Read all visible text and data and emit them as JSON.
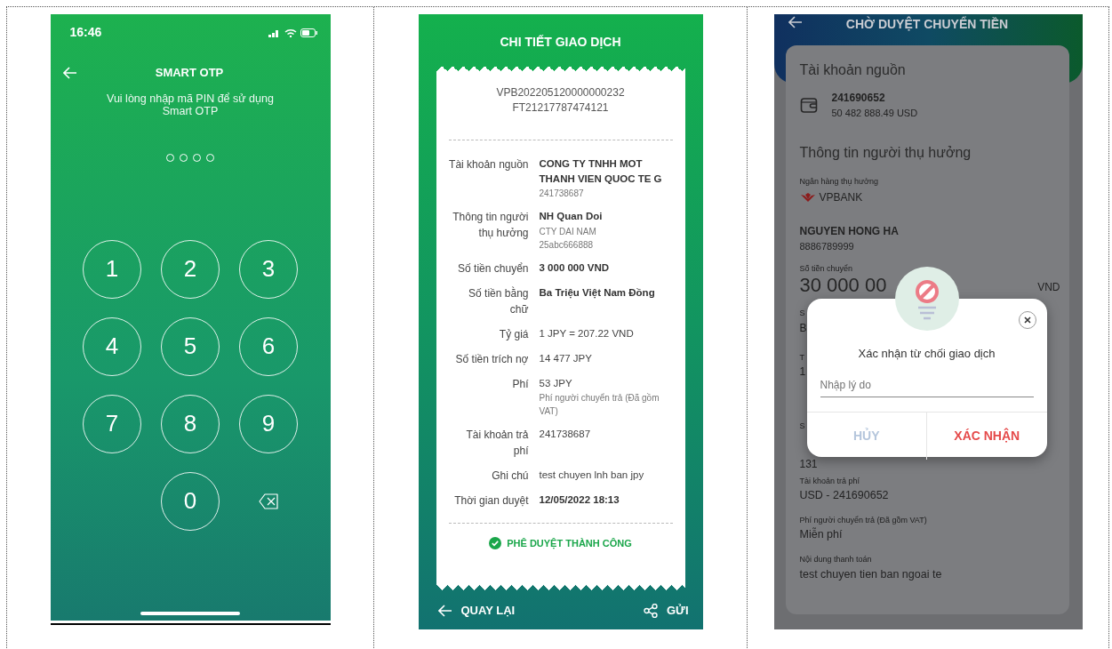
{
  "panel_1": {
    "status_bar": {
      "time": "16:46"
    },
    "title": "SMART OTP",
    "instruction": "Vui lòng nhập mã PIN để sử dụng Smart OTP",
    "pin_dots": [
      {
        "filled": false
      },
      {
        "filled": false
      },
      {
        "filled": false
      },
      {
        "filled": false
      }
    ],
    "keypad": [
      {
        "kind": "digit",
        "label": "1"
      },
      {
        "kind": "digit",
        "label": "2"
      },
      {
        "kind": "digit",
        "label": "3"
      },
      {
        "kind": "digit",
        "label": "4"
      },
      {
        "kind": "digit",
        "label": "5"
      },
      {
        "kind": "digit",
        "label": "6"
      },
      {
        "kind": "digit",
        "label": "7"
      },
      {
        "kind": "digit",
        "label": "8"
      },
      {
        "kind": "digit",
        "label": "9"
      },
      {
        "kind": "blank"
      },
      {
        "kind": "digit",
        "label": "0"
      },
      {
        "kind": "backspace"
      }
    ]
  },
  "panel_2": {
    "title": "CHI TIẾT GIAO DỊCH",
    "references": [
      "VPB202205120000000232",
      "FT21217787474121"
    ],
    "details": [
      {
        "label": "Tài khoản nguồn",
        "values": [
          {
            "kind": "bold",
            "text": "CONG TY TNHH MOT THANH VIEN QUOC TE G"
          },
          {
            "kind": "small",
            "text": "241738687"
          }
        ]
      },
      {
        "label": "Thông tin người thụ hưởng",
        "values": [
          {
            "kind": "bold",
            "text": "NH Quan Doi"
          },
          {
            "kind": "small",
            "text": "CTY DAI NAM"
          },
          {
            "kind": "small",
            "text": "25abc666888"
          }
        ]
      },
      {
        "label": "Số tiền chuyển",
        "values": [
          {
            "kind": "bold",
            "text": "3 000 000 VND"
          }
        ]
      },
      {
        "label": "Số tiền bằng chữ",
        "values": [
          {
            "kind": "bold",
            "text": "Ba Triệu Việt Nam Đồng"
          }
        ]
      },
      {
        "label": "Tỷ giá",
        "values": [
          {
            "kind": "normal",
            "text": "1 JPY = 207.22 VND"
          }
        ]
      },
      {
        "label": "Số tiền trích nợ",
        "values": [
          {
            "kind": "normal",
            "text": "14 477 JPY"
          }
        ]
      },
      {
        "label": "Phí",
        "values": [
          {
            "kind": "normal",
            "text": "53 JPY"
          },
          {
            "kind": "small",
            "text": "Phí người chuyển trả (Đã gồm VAT)"
          }
        ]
      },
      {
        "label": "Tài khoản trả phí",
        "values": [
          {
            "kind": "normal",
            "text": "241738687"
          }
        ]
      },
      {
        "label": "Ghi chú",
        "values": [
          {
            "kind": "normal",
            "text": "test chuyen lnh ban jpy"
          }
        ]
      },
      {
        "label": "Thời gian duyệt",
        "values": [
          {
            "kind": "bold",
            "text": "12/05/2022 18:13"
          }
        ]
      }
    ],
    "status": "PHÊ DUYỆT THÀNH CÔNG",
    "back_button": "QUAY LẠI",
    "send_button": "GỬI"
  },
  "panel_3": {
    "title": "CHỜ DUYỆT CHUYỂN TIỀN",
    "source_heading": "Tài khoản nguồn",
    "source_account": {
      "number": "241690652",
      "balance": "50 482 888.49 USD"
    },
    "beneficiary_heading": "Thông tin người thụ hưởng",
    "bank_label": "Ngân hàng thụ hưởng",
    "bank_name": "VPBANK",
    "beneficiary_name": "NGUYEN HONG HA",
    "beneficiary_account": "8886789999",
    "amount_label": "Số tiền chuyển",
    "amount": "30 000 00",
    "currency": "VND",
    "covered_fields": [
      {
        "label": "S",
        "value": "B"
      },
      {
        "label": "T",
        "value": "1"
      },
      {
        "label": "S",
        "value": "131"
      }
    ],
    "fields": [
      {
        "label": "Tài khoản trả phí",
        "value": "USD - 241690652"
      },
      {
        "label": "Phí người chuyển trả  (Đã gồm VAT)",
        "value": "Miễn phí"
      },
      {
        "label": "Nội dung thanh toán",
        "value": "test chuyen tien ban ngoai te"
      }
    ],
    "dialog": {
      "title": "Xác nhận từ chối giao dịch",
      "reason_field": {
        "placeholder": "Nhập lý do"
      },
      "cancel_button": "HỦY",
      "confirm_button": "XÁC NHẬN"
    }
  }
}
